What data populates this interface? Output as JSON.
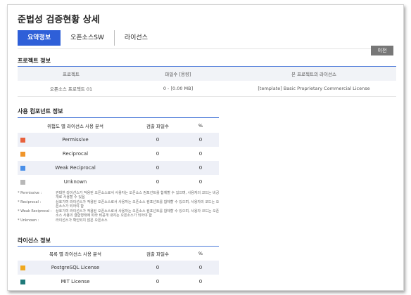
{
  "title": "준법성 검증현황 상세",
  "tabs": [
    {
      "label": "요약정보",
      "active": true
    },
    {
      "label": "오픈소스SW",
      "active": false
    },
    {
      "label": "라이선스",
      "active": false
    }
  ],
  "prev_button": "이전",
  "project_section": {
    "title": "프로젝트 정보",
    "headers": [
      "프로젝트",
      "파일수 [용량]",
      "본 프로젝트의 라이선스"
    ],
    "row": [
      "오픈소스 프로젝트 01",
      "0 - [0.00 MB]",
      "[template] Basic Proprietary Commercial License"
    ]
  },
  "component_section": {
    "title": "사용 컴포넌트 정보",
    "headers": [
      "위험도 별 라이선스 사용 분석",
      "검출 파일수",
      "%"
    ],
    "rows": [
      {
        "color": "#e8613c",
        "label": "Permissive",
        "count": "0",
        "percent": "0"
      },
      {
        "color": "#f0952a",
        "label": "Reciprocal",
        "count": "0",
        "percent": "0"
      },
      {
        "color": "#4a8fe8",
        "label": "Weak Reciprocal",
        "count": "0",
        "percent": "0"
      },
      {
        "color": "#b8b8b8",
        "label": "Unknown",
        "count": "0",
        "percent": "0"
      }
    ]
  },
  "legend": [
    {
      "term": "* Permissive :",
      "desc": "관대한 라이선스가 적용된 오픈소스로서 사용자는 오픈소스 컴포넌트를 합체할 수 있으며, 사용자의 코드는 비공개로 사용할 수 있음"
    },
    {
      "term": "* Reciprocal :",
      "desc": "상호기여 라이선스가 적용된 오픈소스로서 사용자는 오픈소스 컴포넌트를 합체할 수 있으며, 사용자의 코드는 오픈소스가 되어야 함"
    },
    {
      "term": "* Weak Reciprocal :",
      "desc": "상호기여 라이선스가 적용된 오픈소스로서 사용자는 오픈소스 컴포넌트를 합체할 수 있으며, 사용자 코드는 오픈소스 사용의 결합형태에 따라 비공개 내지는 오픈소스가 되어야 함"
    },
    {
      "term": "* Unknown :",
      "desc": "라이선스가 확인되지 않은 오픈소스"
    }
  ],
  "license_section": {
    "title": "라이선스 정보",
    "headers": [
      "목록 별 라이선스 사용 분석",
      "검출 파일수",
      "%"
    ],
    "rows": [
      {
        "color": "#f0a81e",
        "label": "PostgreSQL License",
        "count": "0",
        "percent": "0"
      },
      {
        "color": "#1f7a7a",
        "label": "MIT License",
        "count": "0",
        "percent": "0"
      }
    ]
  }
}
